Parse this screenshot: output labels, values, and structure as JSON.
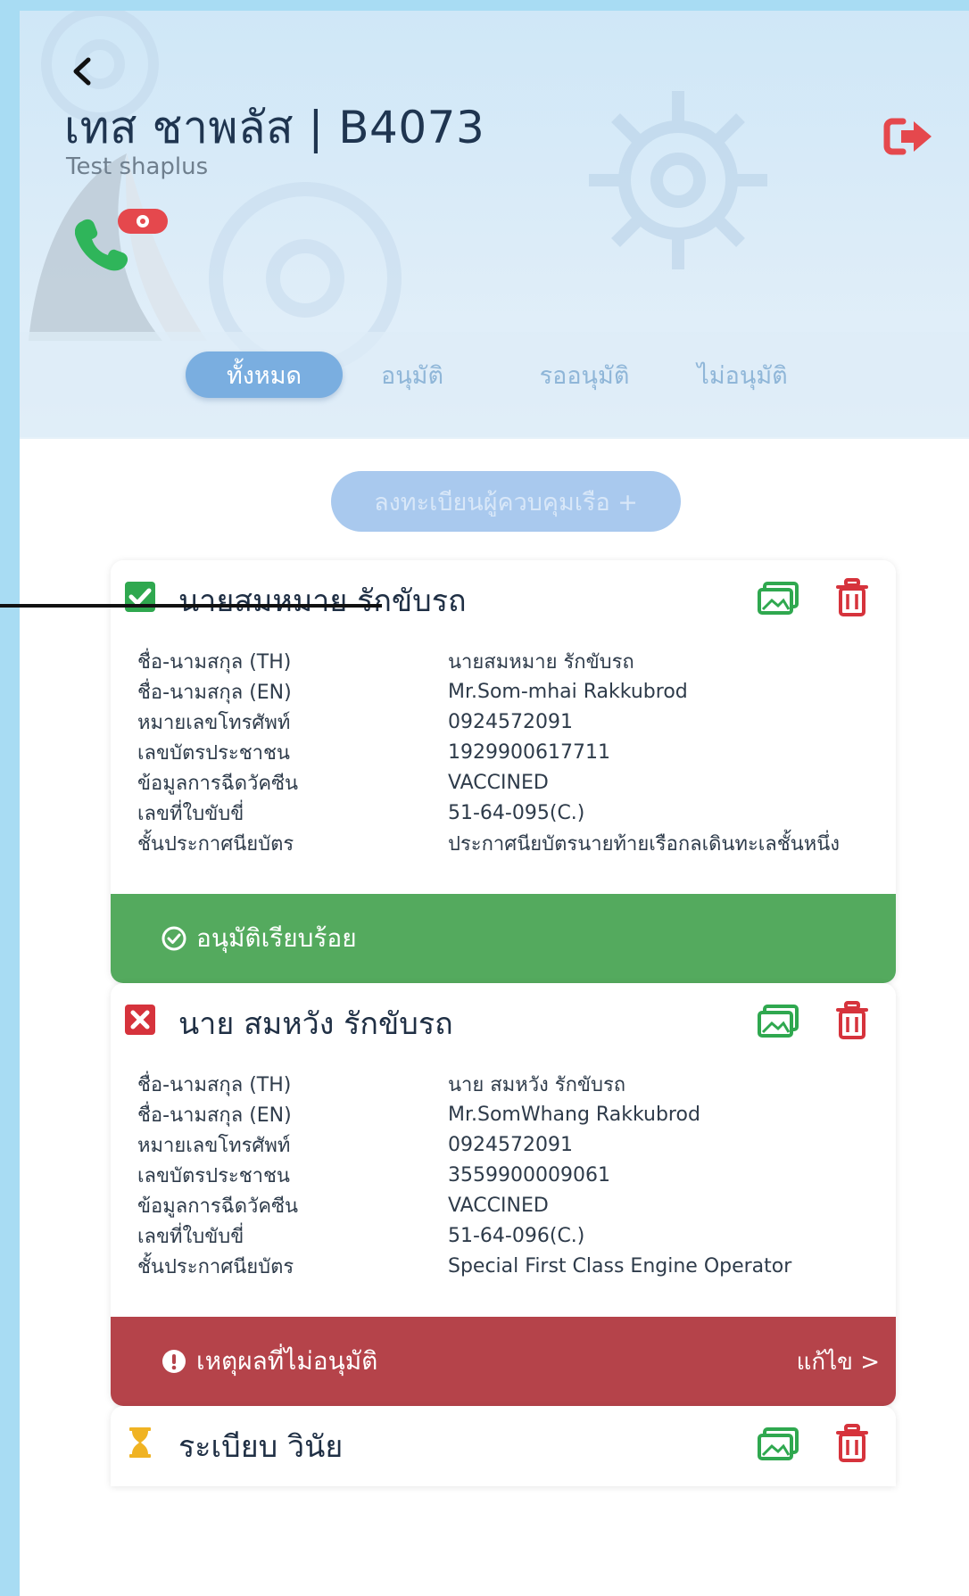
{
  "header": {
    "title": "เทส ชาพลัส | B4073",
    "subtitle": "Test shaplus"
  },
  "tabs": [
    {
      "label": "ทั้งหมด",
      "active": true
    },
    {
      "label": "อนุมัติ",
      "active": false
    },
    {
      "label": "รออนุมัติ",
      "active": false
    },
    {
      "label": "ไม่อนุมัติ",
      "active": false
    }
  ],
  "register_button": "ลงทะเบียนผู้ควบคุมเรือ +",
  "field_labels": {
    "name_th": "ชื่อ-นามสกุล (TH)",
    "name_en": "ชื่อ-นามสกุล (EN)",
    "phone": "หมายเลขโทรศัพท์",
    "id_card": "เลขบัตรประชาชน",
    "vaccine": "ข้อมูลการฉีดวัคซีน",
    "license_no": "เลขที่ใบขับขี่",
    "certificate": "ชั้นประกาศนียบัตร"
  },
  "cards": [
    {
      "name": "นายสมหมาย รักขับรถ",
      "status": "approved",
      "name_th": "นายสมหมาย รักขับรถ",
      "name_en": "Mr.Som-mhai Rakkubrod",
      "phone": "0924572091",
      "id_card": "1929900617711",
      "vaccine": "VACCINED",
      "license_no": "51-64-095(C.)",
      "certificate": "ประกาศนียบัตรนายท้ายเรือกลเดินทะเลชั้นหนึ่ง",
      "footer": "อนุมัติเรียบร้อย"
    },
    {
      "name": "นาย สมหวัง รักขับรถ",
      "status": "rejected",
      "name_th": "นาย สมหวัง รักขับรถ",
      "name_en": "Mr.SomWhang Rakkubrod",
      "phone": "0924572091",
      "id_card": "3559900009061",
      "vaccine": "VACCINED",
      "license_no": "51-64-096(C.)",
      "certificate": "Special First Class Engine Operator",
      "footer": "เหตุผลที่ไม่อนุมัติ",
      "edit_label": "แก้ไข >"
    },
    {
      "name": "ระเบียบ วินัย",
      "status": "pending"
    }
  ],
  "colors": {
    "approved": "#54aa5e",
    "rejected": "#b5434a",
    "pending": "#f0b323",
    "tab_active": "#7aaee0",
    "logout": "#e5484d",
    "phone": "#2fb55a"
  }
}
